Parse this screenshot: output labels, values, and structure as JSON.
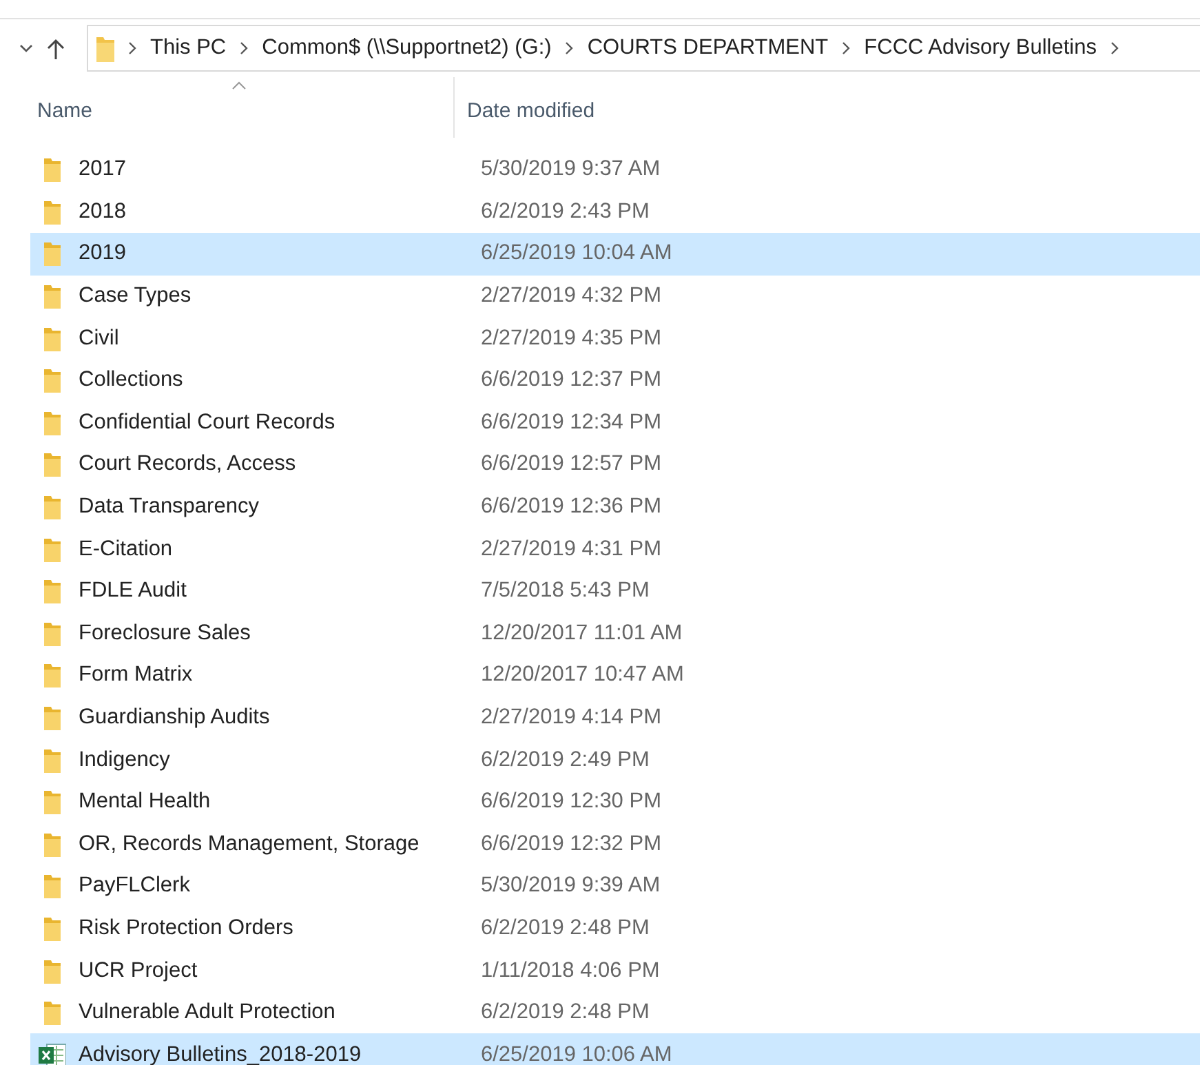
{
  "address_bar": {
    "crumbs": [
      "This PC",
      "Common$ (\\\\Supportnet2) (G:)",
      "COURTS DEPARTMENT",
      "FCCC Advisory Bulletins"
    ]
  },
  "table": {
    "columns": [
      "Name",
      "Date modified"
    ],
    "rows": [
      {
        "kind": "folder",
        "name": "2017",
        "date": "5/30/2019 9:37 AM",
        "selected": false
      },
      {
        "kind": "folder",
        "name": "2018",
        "date": "6/2/2019 2:43 PM",
        "selected": false
      },
      {
        "kind": "folder",
        "name": "2019",
        "date": "6/25/2019 10:04 AM",
        "selected": true
      },
      {
        "kind": "folder",
        "name": "Case Types",
        "date": "2/27/2019 4:32 PM",
        "selected": false
      },
      {
        "kind": "folder",
        "name": "Civil",
        "date": "2/27/2019 4:35 PM",
        "selected": false
      },
      {
        "kind": "folder",
        "name": "Collections",
        "date": "6/6/2019 12:37 PM",
        "selected": false
      },
      {
        "kind": "folder",
        "name": "Confidential Court Records",
        "date": "6/6/2019 12:34 PM",
        "selected": false
      },
      {
        "kind": "folder",
        "name": "Court Records, Access",
        "date": "6/6/2019 12:57 PM",
        "selected": false
      },
      {
        "kind": "folder",
        "name": "Data Transparency",
        "date": "6/6/2019 12:36 PM",
        "selected": false
      },
      {
        "kind": "folder",
        "name": "E-Citation",
        "date": "2/27/2019 4:31 PM",
        "selected": false
      },
      {
        "kind": "folder",
        "name": "FDLE Audit",
        "date": "7/5/2018 5:43 PM",
        "selected": false
      },
      {
        "kind": "folder",
        "name": "Foreclosure Sales",
        "date": "12/20/2017 11:01 AM",
        "selected": false
      },
      {
        "kind": "folder",
        "name": "Form Matrix",
        "date": "12/20/2017 10:47 AM",
        "selected": false
      },
      {
        "kind": "folder",
        "name": "Guardianship Audits",
        "date": "2/27/2019 4:14 PM",
        "selected": false
      },
      {
        "kind": "folder",
        "name": "Indigency",
        "date": "6/2/2019 2:49 PM",
        "selected": false
      },
      {
        "kind": "folder",
        "name": "Mental Health",
        "date": "6/6/2019 12:30 PM",
        "selected": false
      },
      {
        "kind": "folder",
        "name": "OR, Records Management, Storage",
        "date": "6/6/2019 12:32 PM",
        "selected": false
      },
      {
        "kind": "folder",
        "name": "PayFLClerk",
        "date": "5/30/2019 9:39 AM",
        "selected": false
      },
      {
        "kind": "folder",
        "name": "Risk Protection Orders",
        "date": "6/2/2019 2:48 PM",
        "selected": false
      },
      {
        "kind": "folder",
        "name": "UCR Project",
        "date": "1/11/2018 4:06 PM",
        "selected": false
      },
      {
        "kind": "folder",
        "name": "Vulnerable Adult Protection",
        "date": "6/2/2019 2:48 PM",
        "selected": false
      },
      {
        "kind": "spreadsheet",
        "name": "Advisory Bulletins_2018-2019",
        "date": "6/25/2019 10:06 AM",
        "selected": true
      }
    ]
  }
}
